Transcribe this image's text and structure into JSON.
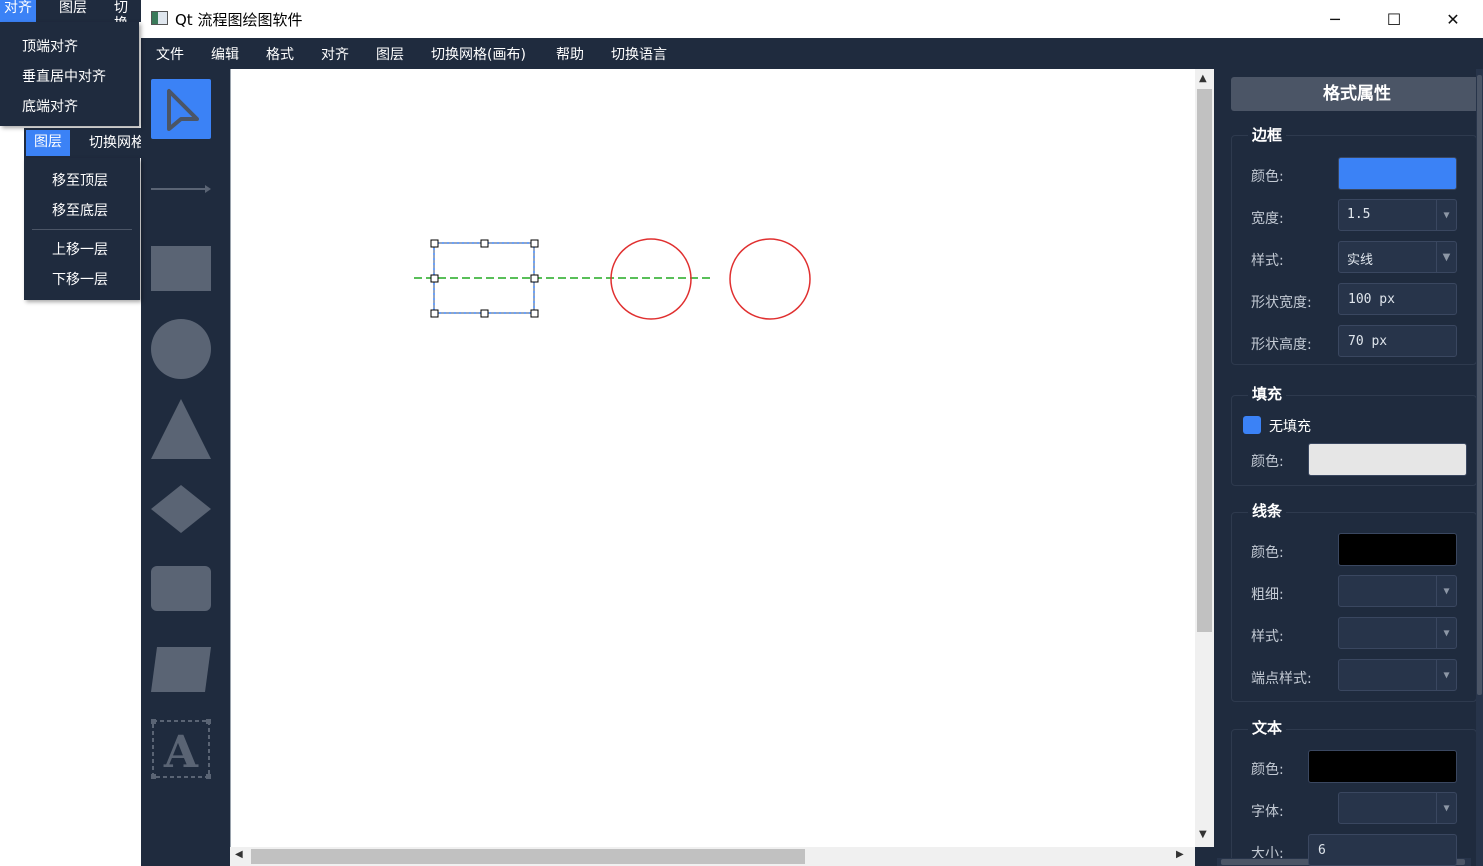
{
  "window": {
    "title": "Qt 流程图绘图软件",
    "controls": {
      "minimize": "─",
      "maximize": "☐",
      "close": "✕"
    }
  },
  "menubar": {
    "items": [
      "文件",
      "编辑",
      "格式",
      "对齐",
      "图层",
      "切换网格(画布)",
      "帮助",
      "切换语言"
    ]
  },
  "popup_align": {
    "strip": [
      "对齐",
      "图层",
      "切换"
    ],
    "items": [
      "顶端对齐",
      "垂直居中对齐",
      "底端对齐"
    ]
  },
  "popup_layer": {
    "strip": [
      "图层",
      "切换网格"
    ],
    "items": [
      "移至顶层",
      "移至底层",
      "上移一层",
      "下移一层"
    ]
  },
  "toolbox": {
    "tools": [
      "pointer-tool",
      "line-tool",
      "rectangle-tool",
      "circle-tool",
      "triangle-tool",
      "diamond-tool",
      "rounded-rect-tool",
      "parallelogram-tool",
      "text-tool"
    ],
    "text_glyph": "A"
  },
  "properties": {
    "header": "格式属性",
    "border": {
      "title": "边框",
      "color_label": "颜色:",
      "color": "#3b82f6",
      "width_label": "宽度:",
      "width_value": "1.5",
      "style_label": "样式:",
      "style_value": "实线",
      "shape_width_label": "形状宽度:",
      "shape_width_value": "100 px",
      "shape_height_label": "形状高度:",
      "shape_height_value": "70 px"
    },
    "fill": {
      "title": "填充",
      "no_fill_label": "无填充",
      "no_fill_checked": true,
      "color_label": "颜色:",
      "color": "#e6e6e6"
    },
    "line": {
      "title": "线条",
      "color_label": "颜色:",
      "color": "#000000",
      "thickness_label": "粗细:",
      "style_label": "样式:",
      "endpoint_label": "端点样式:"
    },
    "text": {
      "title": "文本",
      "color_label": "颜色:",
      "color": "#000000",
      "font_label": "字体:",
      "size_label": "大小:",
      "size_value": "6"
    }
  },
  "colors": {
    "accent": "#3b82f6",
    "dark_bg": "#1f2b3e",
    "circle_stroke": "#e03030",
    "guide_line": "#22aa22"
  }
}
